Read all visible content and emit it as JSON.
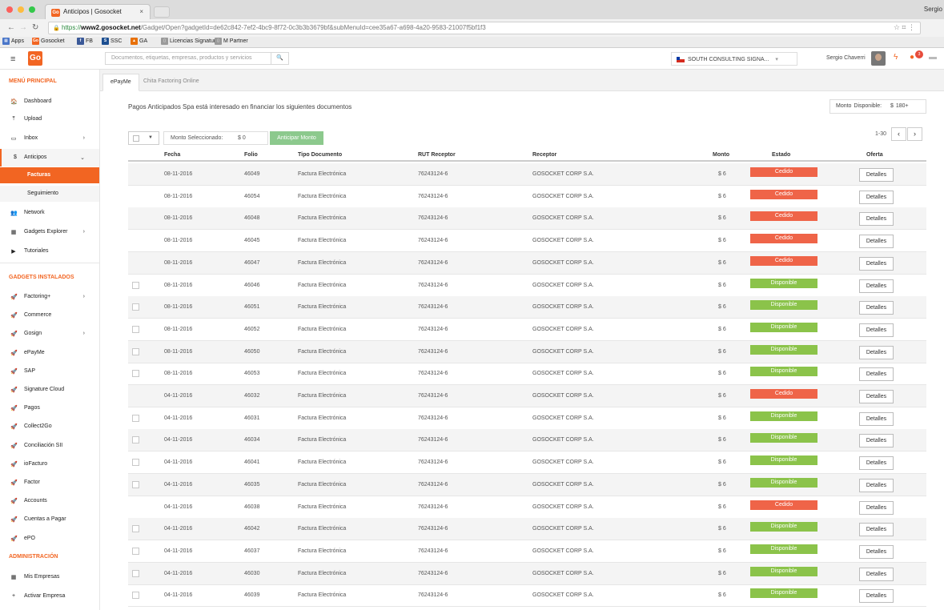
{
  "browser": {
    "tab_title": "Anticipos | Gosocket",
    "tab_favicon": "Go",
    "tab_close": "×",
    "user_corner": "Sergio",
    "url_proto": "https://",
    "url_host": "www2.gosocket.net",
    "url_path": "/Gadget/Open?gadgetId=de62c842-7ef2-4bc9-8f72-0c3b3b3679bf&subMenuId=cee35a67-a698-4a20-9583-21007f5bf1f3",
    "bookmarks": [
      {
        "label": "Apps",
        "icon": "▦",
        "color": "#4a76c9"
      },
      {
        "label": "Gosocket",
        "icon": "Go",
        "color": "#f26522"
      },
      {
        "label": "FB",
        "icon": "f",
        "color": "#3b5998"
      },
      {
        "label": "SSC",
        "icon": "S",
        "color": "#1d4f91"
      },
      {
        "label": "GA",
        "icon": "▲",
        "color": "#e8710a"
      },
      {
        "label": "Licencias Signature",
        "icon": "▯",
        "color": "#9a9a9a"
      },
      {
        "label": "M Partner",
        "icon": "▯",
        "color": "#9a9a9a"
      }
    ]
  },
  "topbar": {
    "logo": "Go",
    "search_placeholder": "Documentos, etiquetas, empresas, productos y servicios",
    "search_icon": "search-icon",
    "company": "SOUTH CONSULTING SIGNA...",
    "company_caret": "▾",
    "user_name": "Sergio Chaverri",
    "notification_count": "3",
    "colors": {
      "brand": "#f26522",
      "flag_red": "#d52b1e",
      "flag_blue": "#0039a6"
    }
  },
  "sidebar": {
    "section_main": "MENÚ PRINCIPAL",
    "section_gadgets": "GADGETS INSTALADOS",
    "section_admin": "ADMINISTRACIÓN",
    "main_items": [
      {
        "label": "Dashboard",
        "icon": "🏠",
        "chev": ""
      },
      {
        "label": "Upload",
        "icon": "⤒",
        "chev": ""
      },
      {
        "label": "Inbox",
        "icon": "▭",
        "chev": "›"
      },
      {
        "label": "Anticipos",
        "icon": "$",
        "chev": "⌄"
      }
    ],
    "sub_items": [
      "Facturas",
      "Seguimiento"
    ],
    "main_items2": [
      {
        "label": "Network",
        "icon": "👥",
        "chev": ""
      },
      {
        "label": "Gadgets Explorer",
        "icon": "▦",
        "chev": "›"
      },
      {
        "label": "Tutoriales",
        "icon": "▶",
        "chev": ""
      }
    ],
    "gadgets": [
      {
        "label": "Factoring+",
        "chev": "›"
      },
      {
        "label": "Commerce",
        "chev": ""
      },
      {
        "label": "Gosign",
        "chev": "›"
      },
      {
        "label": "ePayMe",
        "chev": ""
      },
      {
        "label": "SAP",
        "chev": ""
      },
      {
        "label": "Signature Cloud",
        "chev": ""
      },
      {
        "label": "Pagos",
        "chev": ""
      },
      {
        "label": "Collect2Go",
        "chev": ""
      },
      {
        "label": "Conciliación SII",
        "chev": ""
      },
      {
        "label": "ioFacturo",
        "chev": ""
      },
      {
        "label": "Factor",
        "chev": ""
      },
      {
        "label": "Accounts",
        "chev": ""
      },
      {
        "label": "Cuentas a Pagar",
        "chev": ""
      },
      {
        "label": "ePO",
        "chev": ""
      }
    ],
    "gadget_icon": "🚀",
    "admin_items": [
      {
        "label": "Mis Empresas",
        "icon": "▦"
      },
      {
        "label": "Activar Empresa",
        "icon": "+"
      }
    ]
  },
  "main": {
    "tabs": [
      "ePayMe",
      "Chita Factoring Online"
    ],
    "intro": "Pagos Anticipados Spa está interesado en financiar los siguientes documentos",
    "available_label": "Monto Disponible:",
    "available_value": "$ 180+",
    "selected_label": "Monto Seleccionado:",
    "selected_value": "$ 0",
    "anticipar_label": "Anticipar Monto",
    "pager_text": "1-30",
    "prev": "‹",
    "next": "›",
    "columns": [
      "Fecha",
      "Folio",
      "Tipo Documento",
      "RUT Receptor",
      "Receptor",
      "Monto",
      "Estado",
      "Oferta"
    ],
    "rows": [
      {
        "fecha": "08-11-2016",
        "folio": "46049",
        "tipo": "Factura Electrónica",
        "rut": "76243124-6",
        "receptor": "GOSOCKET CORP S.A.",
        "monto": "$ 6",
        "estado": "Cedido",
        "oferta": "Detalles"
      },
      {
        "fecha": "08-11-2016",
        "folio": "46054",
        "tipo": "Factura Electrónica",
        "rut": "76243124-6",
        "receptor": "GOSOCKET CORP S.A.",
        "monto": "$ 6",
        "estado": "Cedido",
        "oferta": "Detalles"
      },
      {
        "fecha": "08-11-2016",
        "folio": "46048",
        "tipo": "Factura Electrónica",
        "rut": "76243124-6",
        "receptor": "GOSOCKET CORP S.A.",
        "monto": "$ 6",
        "estado": "Cedido",
        "oferta": "Detalles"
      },
      {
        "fecha": "08-11-2016",
        "folio": "46045",
        "tipo": "Factura Electrónica",
        "rut": "76243124-6",
        "receptor": "GOSOCKET CORP S.A.",
        "monto": "$ 6",
        "estado": "Cedido",
        "oferta": "Detalles"
      },
      {
        "fecha": "08-11-2016",
        "folio": "46047",
        "tipo": "Factura Electrónica",
        "rut": "76243124-6",
        "receptor": "GOSOCKET CORP S.A.",
        "monto": "$ 6",
        "estado": "Cedido",
        "oferta": "Detalles"
      },
      {
        "fecha": "08-11-2016",
        "folio": "46046",
        "tipo": "Factura Electrónica",
        "rut": "76243124-6",
        "receptor": "GOSOCKET CORP S.A.",
        "monto": "$ 6",
        "estado": "Disponible",
        "oferta": "Detalles"
      },
      {
        "fecha": "08-11-2016",
        "folio": "46051",
        "tipo": "Factura Electrónica",
        "rut": "76243124-6",
        "receptor": "GOSOCKET CORP S.A.",
        "monto": "$ 6",
        "estado": "Disponible",
        "oferta": "Detalles"
      },
      {
        "fecha": "08-11-2016",
        "folio": "46052",
        "tipo": "Factura Electrónica",
        "rut": "76243124-6",
        "receptor": "GOSOCKET CORP S.A.",
        "monto": "$ 6",
        "estado": "Disponible",
        "oferta": "Detalles"
      },
      {
        "fecha": "08-11-2016",
        "folio": "46050",
        "tipo": "Factura Electrónica",
        "rut": "76243124-6",
        "receptor": "GOSOCKET CORP S.A.",
        "monto": "$ 6",
        "estado": "Disponible",
        "oferta": "Detalles"
      },
      {
        "fecha": "08-11-2016",
        "folio": "46053",
        "tipo": "Factura Electrónica",
        "rut": "76243124-6",
        "receptor": "GOSOCKET CORP S.A.",
        "monto": "$ 6",
        "estado": "Disponible",
        "oferta": "Detalles"
      },
      {
        "fecha": "04-11-2016",
        "folio": "46032",
        "tipo": "Factura Electrónica",
        "rut": "76243124-6",
        "receptor": "GOSOCKET CORP S.A.",
        "monto": "$ 6",
        "estado": "Cedido",
        "oferta": "Detalles"
      },
      {
        "fecha": "04-11-2016",
        "folio": "46031",
        "tipo": "Factura Electrónica",
        "rut": "76243124-6",
        "receptor": "GOSOCKET CORP S.A.",
        "monto": "$ 6",
        "estado": "Disponible",
        "oferta": "Detalles"
      },
      {
        "fecha": "04-11-2016",
        "folio": "46034",
        "tipo": "Factura Electrónica",
        "rut": "76243124-6",
        "receptor": "GOSOCKET CORP S.A.",
        "monto": "$ 6",
        "estado": "Disponible",
        "oferta": "Detalles"
      },
      {
        "fecha": "04-11-2016",
        "folio": "46041",
        "tipo": "Factura Electrónica",
        "rut": "76243124-6",
        "receptor": "GOSOCKET CORP S.A.",
        "monto": "$ 6",
        "estado": "Disponible",
        "oferta": "Detalles"
      },
      {
        "fecha": "04-11-2016",
        "folio": "46035",
        "tipo": "Factura Electrónica",
        "rut": "76243124-6",
        "receptor": "GOSOCKET CORP S.A.",
        "monto": "$ 6",
        "estado": "Disponible",
        "oferta": "Detalles"
      },
      {
        "fecha": "04-11-2016",
        "folio": "46038",
        "tipo": "Factura Electrónica",
        "rut": "76243124-6",
        "receptor": "GOSOCKET CORP S.A.",
        "monto": "$ 6",
        "estado": "Cedido",
        "oferta": "Detalles"
      },
      {
        "fecha": "04-11-2016",
        "folio": "46042",
        "tipo": "Factura Electrónica",
        "rut": "76243124-6",
        "receptor": "GOSOCKET CORP S.A.",
        "monto": "$ 6",
        "estado": "Disponible",
        "oferta": "Detalles"
      },
      {
        "fecha": "04-11-2016",
        "folio": "46037",
        "tipo": "Factura Electrónica",
        "rut": "76243124-6",
        "receptor": "GOSOCKET CORP S.A.",
        "monto": "$ 6",
        "estado": "Disponible",
        "oferta": "Detalles"
      },
      {
        "fecha": "04-11-2016",
        "folio": "46030",
        "tipo": "Factura Electrónica",
        "rut": "76243124-6",
        "receptor": "GOSOCKET CORP S.A.",
        "monto": "$ 6",
        "estado": "Disponible",
        "oferta": "Detalles"
      },
      {
        "fecha": "04-11-2016",
        "folio": "46039",
        "tipo": "Factura Electrónica",
        "rut": "76243124-6",
        "receptor": "GOSOCKET CORP S.A.",
        "monto": "$ 6",
        "estado": "Disponible",
        "oferta": "Detalles"
      }
    ],
    "status_colors": {
      "Cedido": "#ef6448",
      "Disponible": "#8bc34a"
    }
  }
}
